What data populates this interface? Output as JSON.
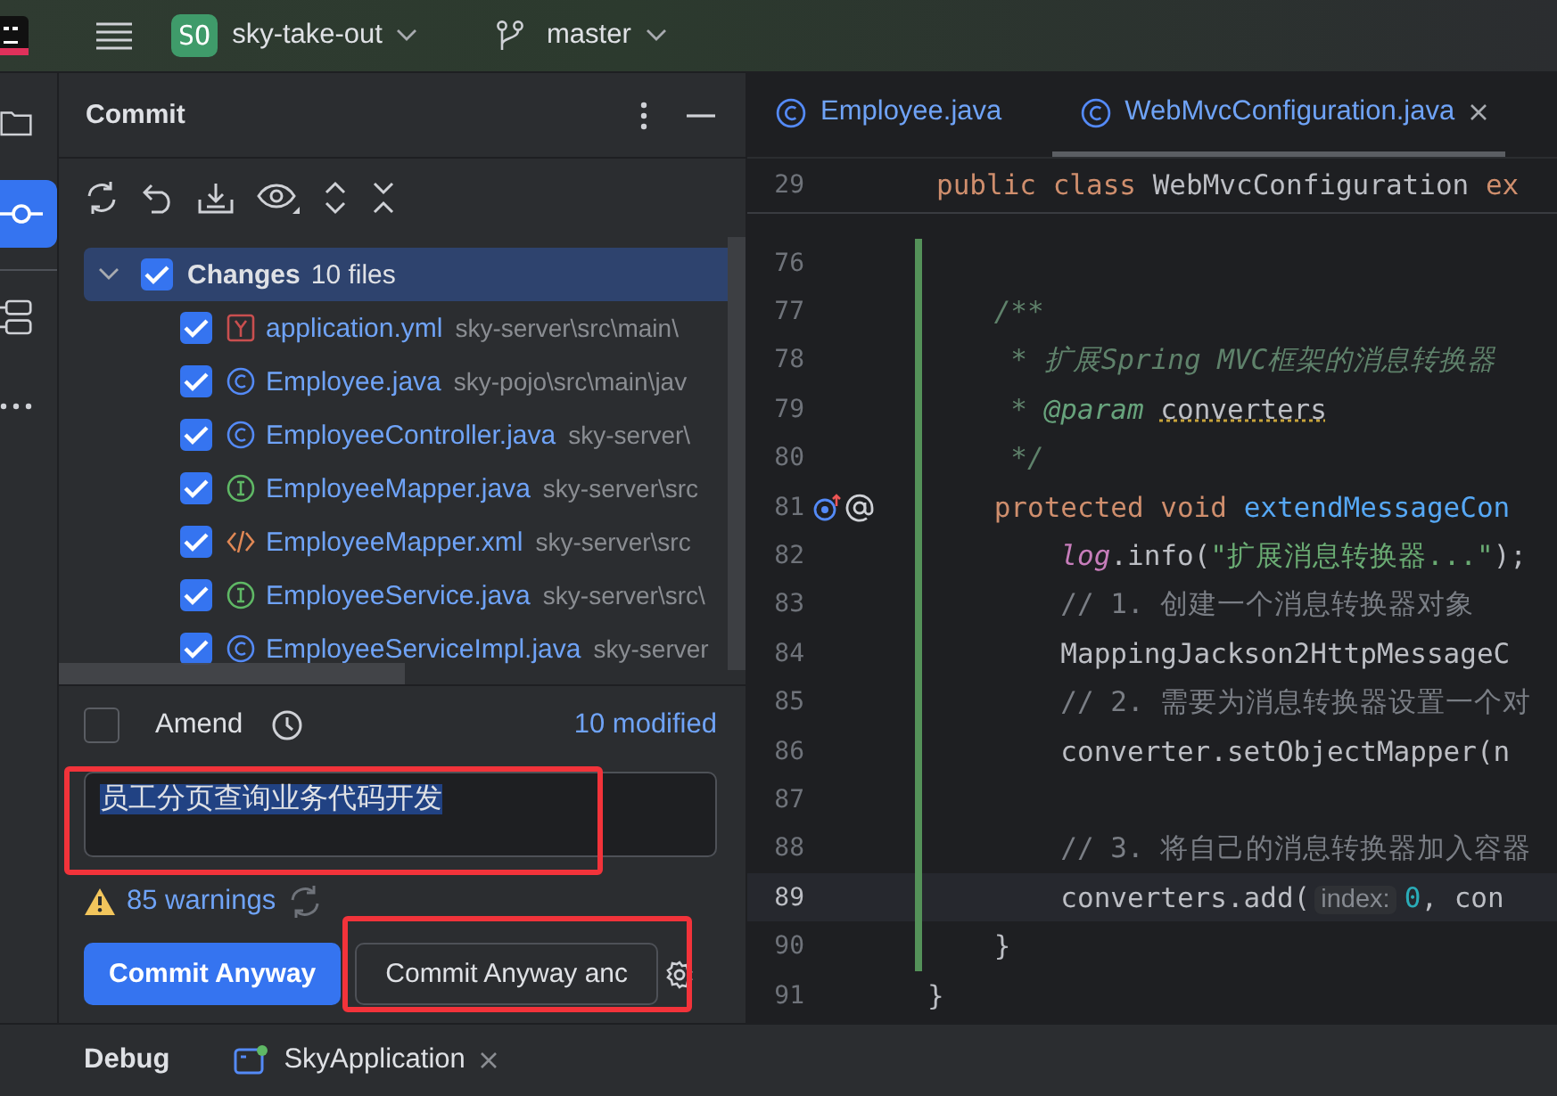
{
  "topbar": {
    "project_badge": "SO",
    "project": "sky-take-out",
    "branch": "master"
  },
  "sidebar": {
    "items": [
      {
        "kind": "folder",
        "selected": false
      },
      {
        "kind": "commit",
        "selected": true
      },
      {
        "kind": "structure",
        "selected": false
      },
      {
        "kind": "more",
        "selected": false
      }
    ]
  },
  "commit": {
    "title": "Commit",
    "changes": {
      "label": "Changes",
      "count": "10 files",
      "checked": true,
      "expanded": true,
      "selected": true
    },
    "files": [
      {
        "name": "application.yml",
        "path": "sky-server\\src\\main\\",
        "kind": "yaml",
        "checked": true
      },
      {
        "name": "Employee.java",
        "path": "sky-pojo\\src\\main\\jav",
        "kind": "class",
        "checked": true
      },
      {
        "name": "EmployeeController.java",
        "path": "sky-server\\",
        "kind": "class",
        "checked": true
      },
      {
        "name": "EmployeeMapper.java",
        "path": "sky-server\\src",
        "kind": "interface",
        "checked": true
      },
      {
        "name": "EmployeeMapper.xml",
        "path": "sky-server\\src",
        "kind": "xml",
        "checked": true
      },
      {
        "name": "EmployeeService.java",
        "path": "sky-server\\src\\",
        "kind": "interface",
        "checked": true
      },
      {
        "name": "EmployeeServiceImpl.java",
        "path": "sky-server",
        "kind": "class",
        "checked": true
      }
    ],
    "amend": {
      "label": "Amend",
      "checked": false
    },
    "modified": "10 modified",
    "message": {
      "value": "员工分页查询业务代码开发",
      "selected": true,
      "highlighted": true
    },
    "warnings": "85 warnings",
    "buttons": [
      {
        "label": "Commit Anyway",
        "kind": "primary"
      },
      {
        "label": "Commit Anyway anc",
        "kind": "secondary",
        "highlighted": true
      }
    ]
  },
  "editor": {
    "tabs": [
      {
        "label": "Employee.java",
        "selected": false,
        "closable": false
      },
      {
        "label": "WebMvcConfiguration.java",
        "selected": true,
        "closable": true
      }
    ],
    "sticky_line": {
      "number": "29",
      "tokens": [
        {
          "kind": "kw",
          "text": "public class "
        },
        {
          "kind": "plain",
          "text": "WebMvcConfiguration "
        },
        {
          "kind": "kw",
          "text": "ex"
        }
      ]
    },
    "lines": [
      {
        "number": "76",
        "modified": true,
        "current": false
      },
      {
        "number": "77",
        "modified": true,
        "current": false,
        "tokens": [
          {
            "kind": "doc",
            "text": "    /**"
          }
        ]
      },
      {
        "number": "78",
        "modified": true,
        "current": false,
        "tokens": [
          {
            "kind": "doc",
            "text": "     * 扩展Spring MVC框架的消息转换器"
          }
        ]
      },
      {
        "number": "79",
        "modified": true,
        "current": false,
        "tokens": [
          {
            "kind": "doc",
            "text": "     * "
          },
          {
            "kind": "doctag",
            "text": "@param "
          },
          {
            "kind": "docref",
            "text": "converters"
          }
        ]
      },
      {
        "number": "80",
        "modified": true,
        "current": false,
        "tokens": [
          {
            "kind": "doc",
            "text": "     */"
          }
        ]
      },
      {
        "number": "81",
        "modified": true,
        "current": false,
        "gutter_icons": [
          {
            "kind": "override"
          },
          {
            "kind": "annotation"
          }
        ],
        "tokens": [
          {
            "kind": "kw",
            "text": "    protected void "
          },
          {
            "kind": "method",
            "text": "extendMessageCon"
          }
        ]
      },
      {
        "number": "82",
        "modified": true,
        "current": false,
        "tokens": [
          {
            "kind": "field",
            "text": "        log"
          },
          {
            "kind": "plain",
            "text": ".info("
          },
          {
            "kind": "str",
            "text": "\"扩展消息转换器...\""
          },
          {
            "kind": "plain",
            "text": ");"
          }
        ]
      },
      {
        "number": "83",
        "modified": true,
        "current": false,
        "tokens": [
          {
            "kind": "comment",
            "text": "        // 1. 创建一个消息转换器对象"
          }
        ]
      },
      {
        "number": "84",
        "modified": true,
        "current": false,
        "tokens": [
          {
            "kind": "plain",
            "text": "        MappingJackson2HttpMessageC"
          }
        ]
      },
      {
        "number": "85",
        "modified": true,
        "current": false,
        "tokens": [
          {
            "kind": "comment",
            "text": "        // 2. 需要为消息转换器设置一个对"
          }
        ]
      },
      {
        "number": "86",
        "modified": true,
        "current": false,
        "tokens": [
          {
            "kind": "plain",
            "text": "        converter.setObjectMapper(n"
          }
        ]
      },
      {
        "number": "87",
        "modified": true,
        "current": false
      },
      {
        "number": "88",
        "modified": true,
        "current": false,
        "tokens": [
          {
            "kind": "comment",
            "text": "        // 3. 将自己的消息转换器加入容器"
          }
        ]
      },
      {
        "number": "89",
        "modified": true,
        "current": true,
        "tokens": [
          {
            "kind": "plain",
            "text": "        converters.add("
          },
          {
            "kind": "hint",
            "text": "index:"
          },
          {
            "kind": "num",
            "text": "0"
          },
          {
            "kind": "plain",
            "text": ", con"
          }
        ]
      },
      {
        "number": "90",
        "modified": true,
        "current": false,
        "tokens": [
          {
            "kind": "plain",
            "text": "    }"
          }
        ]
      },
      {
        "number": "91",
        "modified": false,
        "current": false,
        "tokens": [
          {
            "kind": "plain",
            "text": "}"
          }
        ]
      }
    ]
  },
  "bottom_bar": {
    "title": "Debug",
    "session": "SkyApplication",
    "running": true
  }
}
